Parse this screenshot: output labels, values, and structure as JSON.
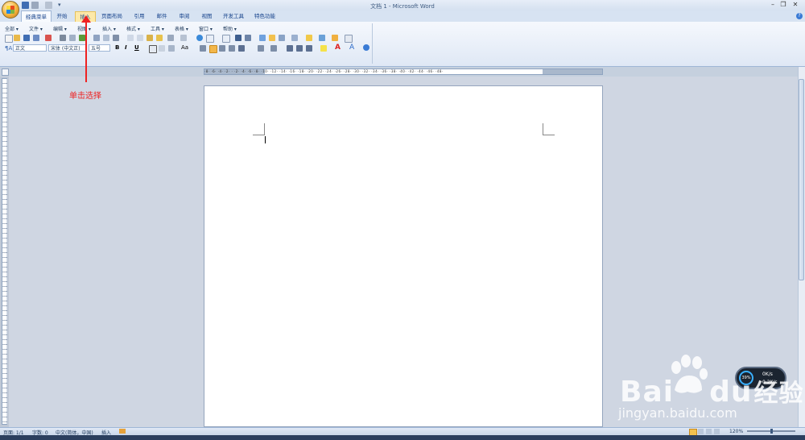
{
  "window": {
    "title": "文档 1 - Microsoft Word"
  },
  "tabs": [
    {
      "label": "经典菜单",
      "state": "active"
    },
    {
      "label": "开始",
      "state": "normal"
    },
    {
      "label": "插入",
      "state": "hover"
    },
    {
      "label": "页面布局",
      "state": "normal"
    },
    {
      "label": "引用",
      "state": "normal"
    },
    {
      "label": "邮件",
      "state": "normal"
    },
    {
      "label": "审阅",
      "state": "normal"
    },
    {
      "label": "视图",
      "state": "normal"
    },
    {
      "label": "开发工具",
      "state": "normal"
    },
    {
      "label": "特色功能",
      "state": "normal"
    }
  ],
  "menu": [
    "全部 ▾",
    "文件 ▾",
    "编辑 ▾",
    "视图 ▾",
    "插入 ▾",
    "格式 ▾",
    "工具 ▾",
    "表格 ▾",
    "窗口 ▾",
    "帮助 ▾"
  ],
  "format": {
    "style": "正文",
    "font": "宋体 (中文正)",
    "size": "五号",
    "bold": "B",
    "italic": "I",
    "underline": "U"
  },
  "ruler": {
    "numbers": "·8· ·6· ·4· ·2· · ·2· ·4· ·6· ·8· ·10· ·12· ·14· ·16· ·18· ·20· ·22· ·24· ·26· ·28· ·30· ·32· ·34· ·36· ·38· ·40· ·42· ·44· ·46· ·48·"
  },
  "status": {
    "page": "页面: 1/1",
    "words": "字数: 0",
    "lang": "中文(简体，中国)",
    "mode": "插入",
    "zoom": "120%"
  },
  "annotation": {
    "text": "单击选择",
    "color": "#ee2222"
  },
  "watermark": {
    "brand": "Bai",
    "brand2": "du",
    "cn": "经验",
    "url": "jingyan.baidu.com"
  },
  "netwidget": {
    "percent": "39%",
    "up": "0K/s",
    "down": "0.2K/s"
  }
}
